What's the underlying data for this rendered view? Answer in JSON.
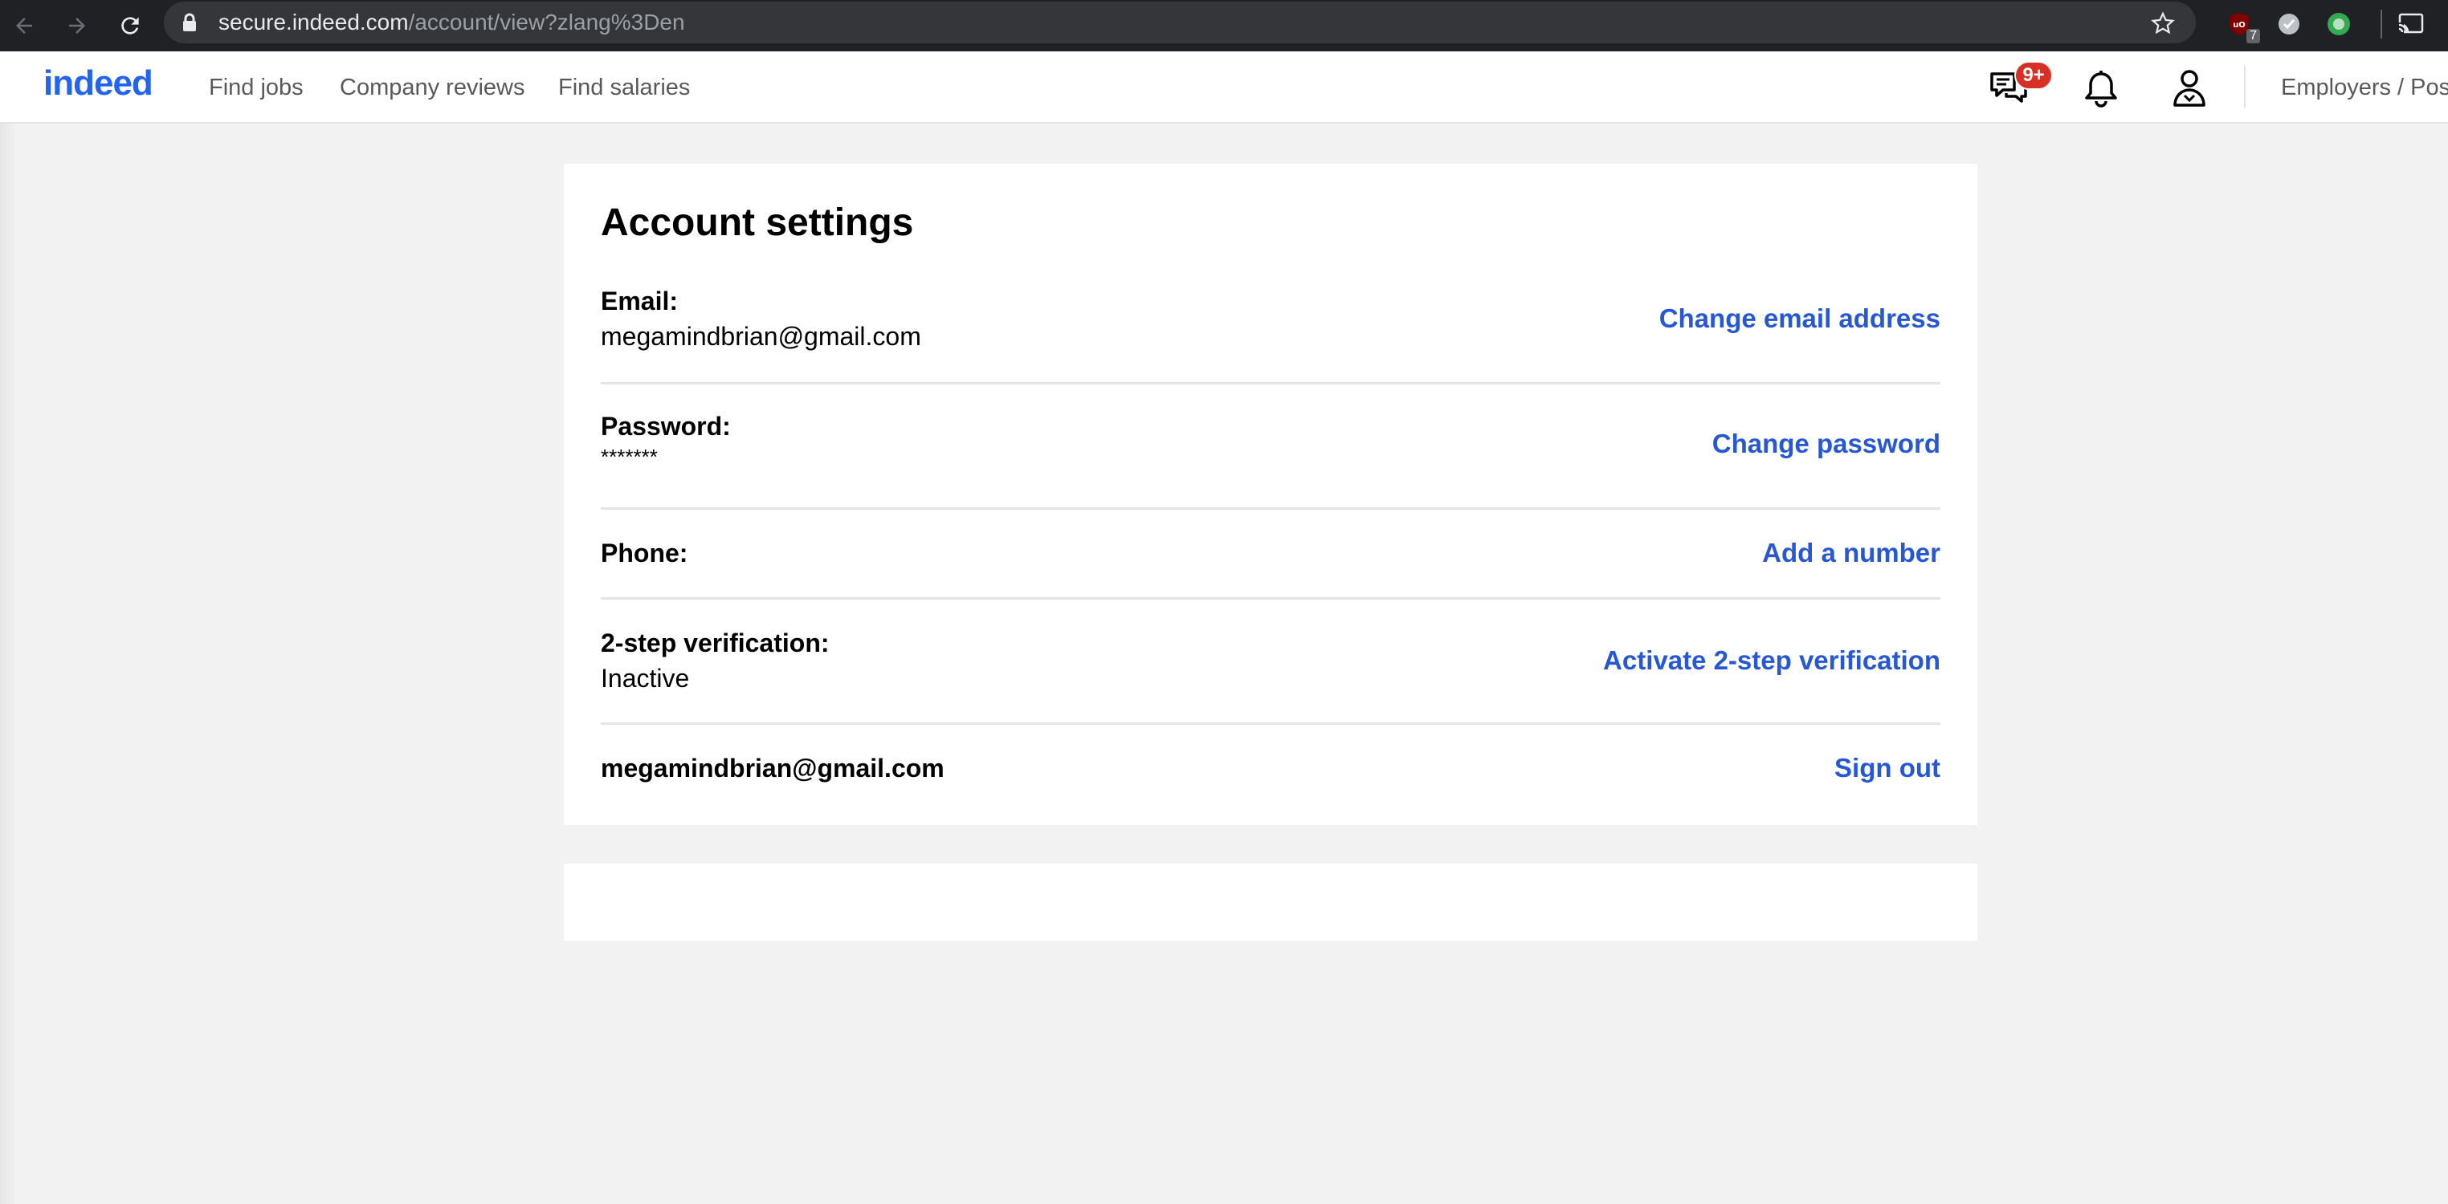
{
  "browser": {
    "url_host": "secure.indeed.com",
    "url_path": "/account/view?zlang%3Den",
    "extension_badge": "7"
  },
  "header": {
    "logo": "indeed",
    "nav": [
      "Find jobs",
      "Company reviews",
      "Find salaries"
    ],
    "messages_badge": "9+",
    "employers_link": "Employers / Post Job"
  },
  "account": {
    "title": "Account settings",
    "email_label": "Email:",
    "email_value": "megamindbrian@gmail.com",
    "email_action": "Change email address",
    "password_label": "Password:",
    "password_value": "*******",
    "password_action": "Change password",
    "phone_label": "Phone:",
    "phone_action": "Add a number",
    "twostep_label": "2-step verification:",
    "twostep_value": "Inactive",
    "twostep_action": "Activate 2-step verification",
    "signed_in_email": "megamindbrian@gmail.com",
    "signout_action": "Sign out"
  },
  "colors": {
    "brand": "#2164f3",
    "link": "#2557d6",
    "badge": "#d93025"
  }
}
